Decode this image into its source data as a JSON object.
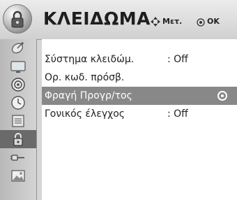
{
  "header": {
    "title": "ΚΛΕΙΔΩΜΑ",
    "hint_move": "Μετ.",
    "hint_ok": "OK",
    "icon": "lock-icon"
  },
  "sidebar": {
    "items": [
      {
        "icon": "satellite-dish-icon"
      },
      {
        "icon": "tv-screen-icon"
      },
      {
        "icon": "speaker-icon"
      },
      {
        "icon": "clock-icon"
      },
      {
        "icon": "settings-icon"
      },
      {
        "icon": "lock-icon",
        "active": true
      },
      {
        "icon": "plug-icon"
      },
      {
        "icon": "photo-icon"
      }
    ]
  },
  "menu": {
    "items": [
      {
        "label": "Σύστημα κλειδώμ.",
        "value": ": Off"
      },
      {
        "label": "Ορ. κωδ. πρόσβ.",
        "value": ""
      },
      {
        "label": "Φραγή Προγρ/τος",
        "value": "",
        "selected": true
      },
      {
        "label": "Γονικός έλεγχος",
        "value": ": Off"
      }
    ]
  },
  "colors": {
    "selected_row": "#888888",
    "active_sidebar": "#6a6a6a"
  }
}
